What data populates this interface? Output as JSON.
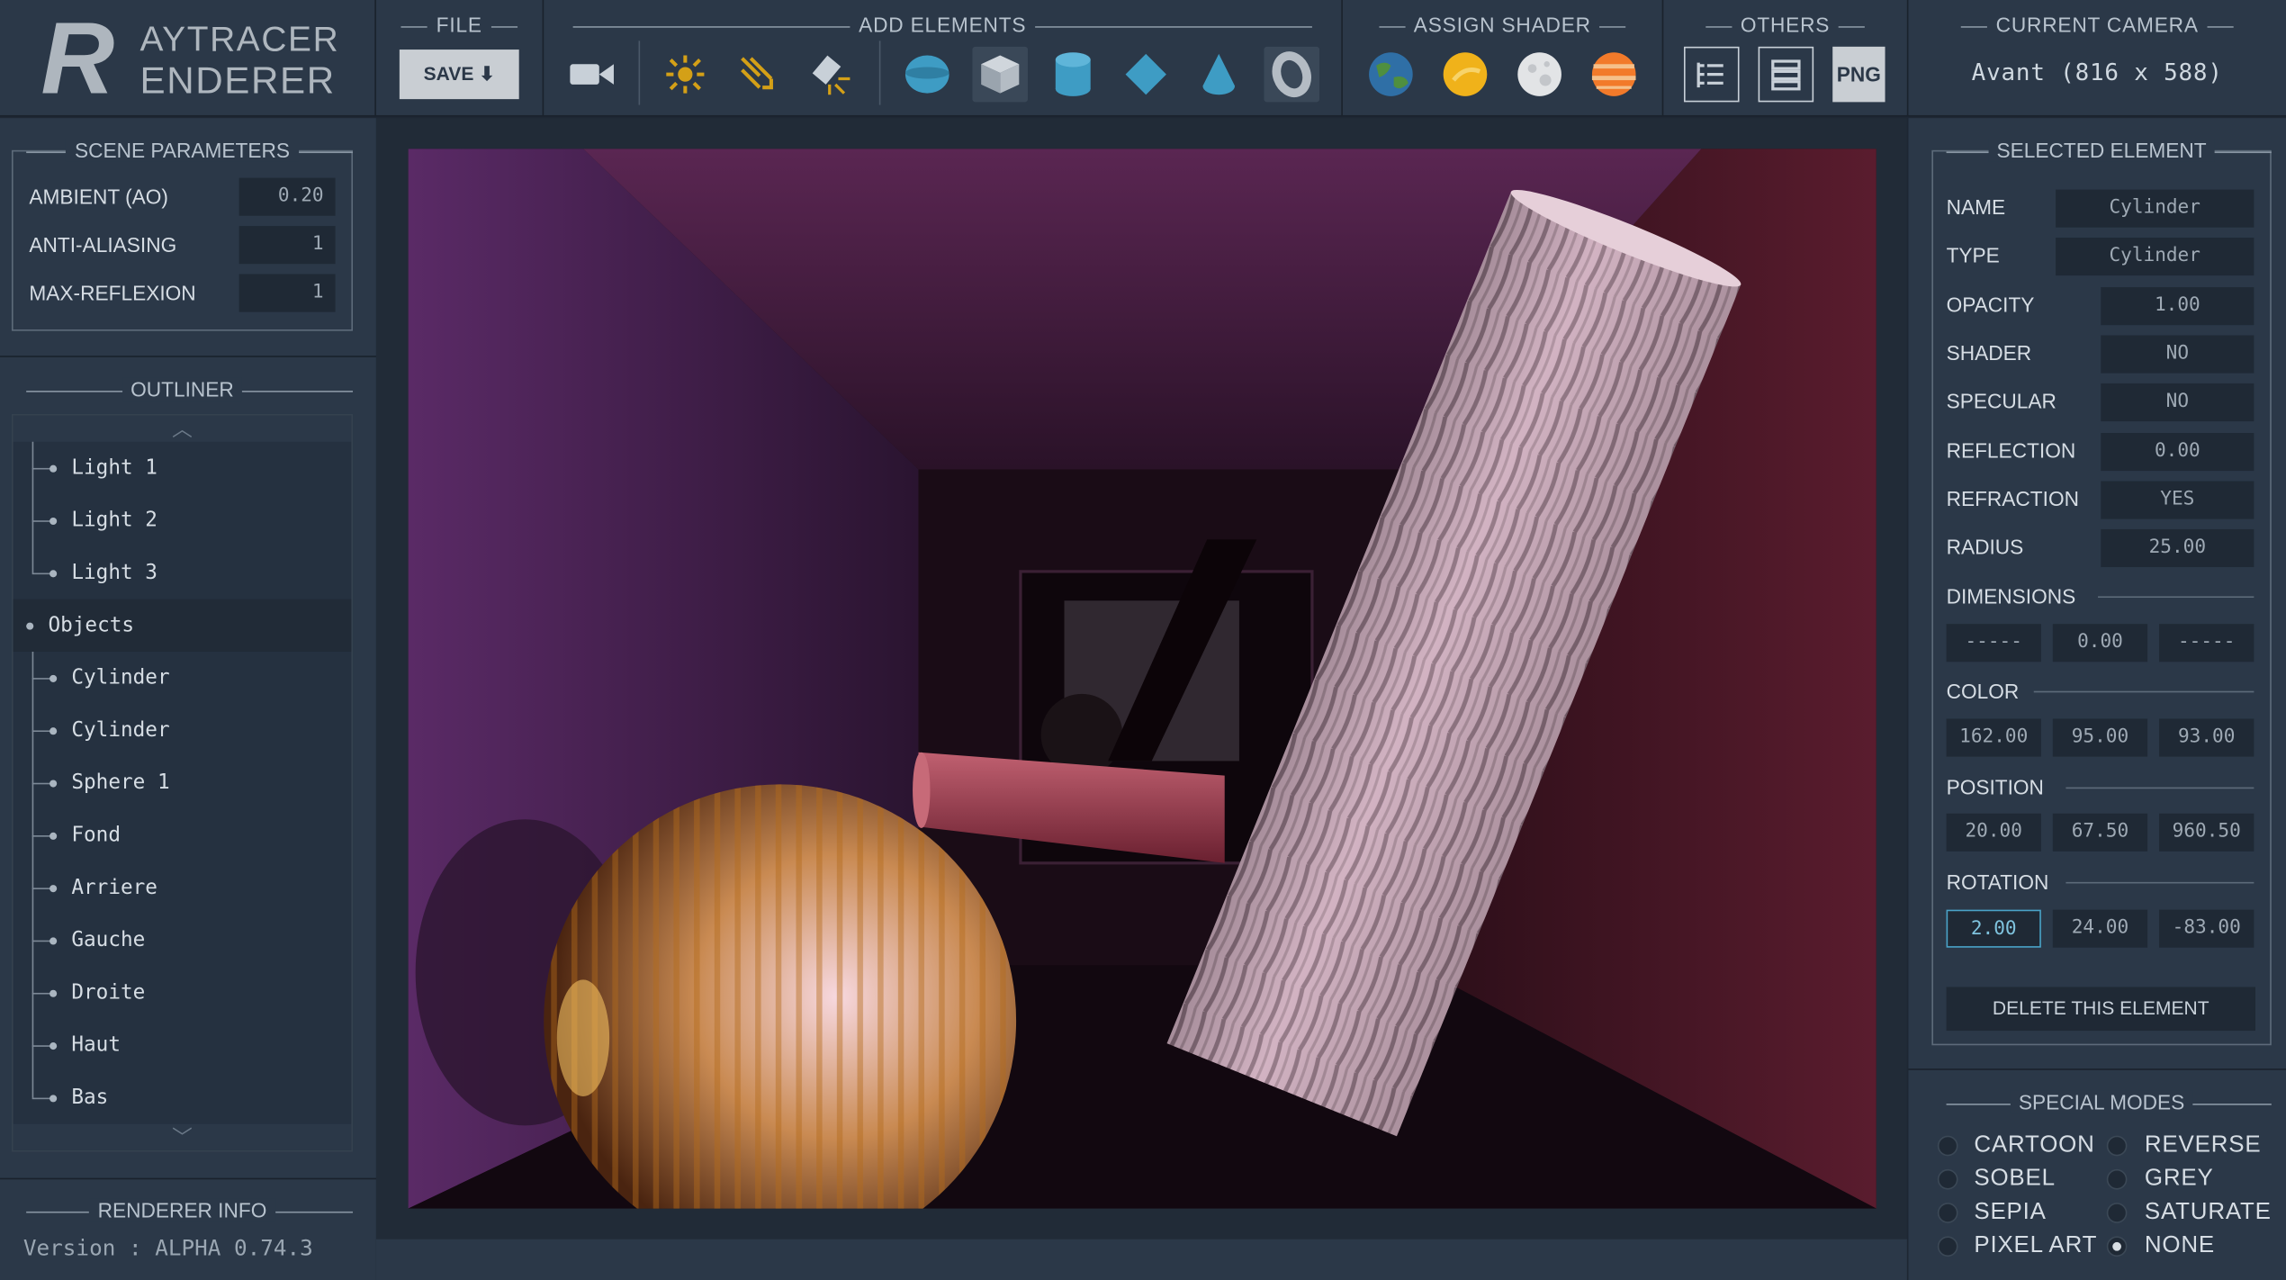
{
  "logo": {
    "letter": "R",
    "line1": "AYTRACER",
    "line2": "ENDERER"
  },
  "toolbar": {
    "file_title": "FILE",
    "save_label": "SAVE",
    "add_title": "ADD ELEMENTS",
    "shader_title": "ASSIGN SHADER",
    "others_title": "OTHERS",
    "png_label": "PNG",
    "camera_title": "CURRENT CAMERA",
    "camera_value": "Avant (816 x 588)"
  },
  "scene": {
    "title": "SCENE PARAMETERS",
    "params": [
      {
        "label": "AMBIENT (AO)",
        "value": "0.20"
      },
      {
        "label": "ANTI-ALIASING",
        "value": "1"
      },
      {
        "label": "MAX-REFLEXION",
        "value": "1"
      }
    ]
  },
  "outliner": {
    "title": "OUTLINER",
    "items": [
      {
        "label": "Light 1"
      },
      {
        "label": "Light 2"
      },
      {
        "label": "Light 3"
      },
      {
        "label": "Objects"
      },
      {
        "label": "Cylinder"
      },
      {
        "label": "Cylinder"
      },
      {
        "label": "Sphere 1"
      },
      {
        "label": "Fond"
      },
      {
        "label": "Arriere"
      },
      {
        "label": "Gauche"
      },
      {
        "label": "Droite"
      },
      {
        "label": "Haut"
      },
      {
        "label": "Bas"
      }
    ]
  },
  "info": {
    "title": "RENDERER INFO",
    "version": "Version : ALPHA 0.74.3"
  },
  "selected": {
    "title": "SELECTED ELEMENT",
    "name_label": "NAME",
    "name": "Cylinder",
    "type_label": "TYPE",
    "type": "Cylinder",
    "opacity_label": "OPACITY",
    "opacity": "1.00",
    "shader_label": "SHADER",
    "shader": "NO",
    "specular_label": "SPECULAR",
    "specular": "NO",
    "reflection_label": "REFLECTION",
    "reflection": "0.00",
    "refraction_label": "REFRACTION",
    "refraction": "YES",
    "radius_label": "RADIUS",
    "radius": "25.00",
    "dimensions_label": "DIMENSIONS",
    "dimensions": [
      "-----",
      "0.00",
      "-----"
    ],
    "color_label": "COLOR",
    "color": [
      "162.00",
      "95.00",
      "93.00"
    ],
    "position_label": "POSITION",
    "position": [
      "20.00",
      "67.50",
      "960.50"
    ],
    "rotation_label": "ROTATION",
    "rotation": [
      "2.00",
      "24.00",
      "-83.00"
    ],
    "delete_label": "DELETE THIS ELEMENT"
  },
  "modes": {
    "title": "SPECIAL MODES",
    "items": [
      {
        "label": "CARTOON",
        "checked": false
      },
      {
        "label": "REVERSE",
        "checked": false
      },
      {
        "label": "SOBEL",
        "checked": false
      },
      {
        "label": "GREY",
        "checked": false
      },
      {
        "label": "SEPIA",
        "checked": false
      },
      {
        "label": "SATURATE",
        "checked": false
      },
      {
        "label": "PIXEL ART",
        "checked": false
      },
      {
        "label": "NONE",
        "checked": true
      }
    ]
  },
  "colors": {
    "panel": "#2b3848",
    "dark": "#1e2733",
    "field": "#1f2935",
    "accent": "#4aa3c8",
    "gold": "#d4a017"
  }
}
